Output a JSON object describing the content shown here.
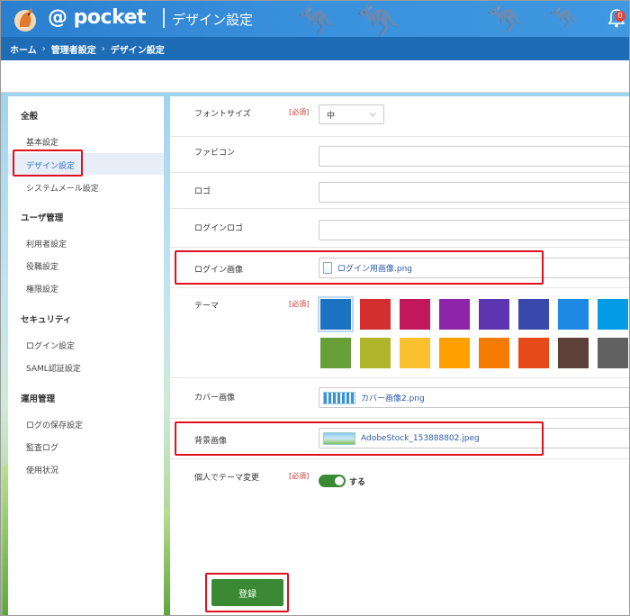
{
  "header": {
    "logo_text": "@ pocket",
    "title": "デザイン設定",
    "icons": {
      "logo": "kangaroo-logo-icon",
      "notifications": "bell-icon"
    },
    "notification_count": "0",
    "colors": {
      "header_bg": "#3a91dc",
      "crumb_bg": "#1d6cb5"
    }
  },
  "breadcrumb": [
    "ホーム",
    "管理者設定",
    "デザイン設定"
  ],
  "sidebar": {
    "groups": [
      {
        "title": "全般",
        "items": [
          "基本設定",
          "デザイン設定",
          "システムメール設定"
        ]
      },
      {
        "title": "ユーザ管理",
        "items": [
          "利用者設定",
          "役職設定",
          "権限設定"
        ]
      },
      {
        "title": "セキュリティ",
        "items": [
          "ログイン設定",
          "SAML認証設定"
        ]
      },
      {
        "title": "運用管理",
        "items": [
          "ログの保存設定",
          "監査ログ",
          "使用状況"
        ]
      }
    ],
    "active_item": "デザイン設定"
  },
  "form": {
    "required_label": "[必須]",
    "font_size": {
      "label": "フォントサイズ",
      "value": "中"
    },
    "favicon": {
      "label": "ファビコン",
      "value": ""
    },
    "logo": {
      "label": "ロゴ",
      "value": ""
    },
    "login_logo": {
      "label": "ログインロゴ",
      "value": ""
    },
    "login_image": {
      "label": "ログイン画像",
      "value": "ログイン用画像.png"
    },
    "theme": {
      "label": "テーマ",
      "colors": [
        "#1a72c0",
        "#d32f2f",
        "#c2185b",
        "#8e24aa",
        "#5e35b1",
        "#3949ab",
        "#1e88e5",
        "#039be5",
        "#689f38",
        "#afb42b",
        "#fbc02d",
        "#ffa000",
        "#f57c00",
        "#e64a19",
        "#5d4037",
        "#616161"
      ],
      "selected_index": 0
    },
    "cover_image": {
      "label": "カバー画像",
      "value": "カバー画像2.png"
    },
    "background_image": {
      "label": "背景画像",
      "value": "AdobeStock_153888802.jpeg"
    },
    "personal_theme": {
      "label": "個人でテーマ変更",
      "toggle_label": "する",
      "enabled": true
    },
    "submit_label": "登録"
  },
  "highlight_color": "#e0101e"
}
